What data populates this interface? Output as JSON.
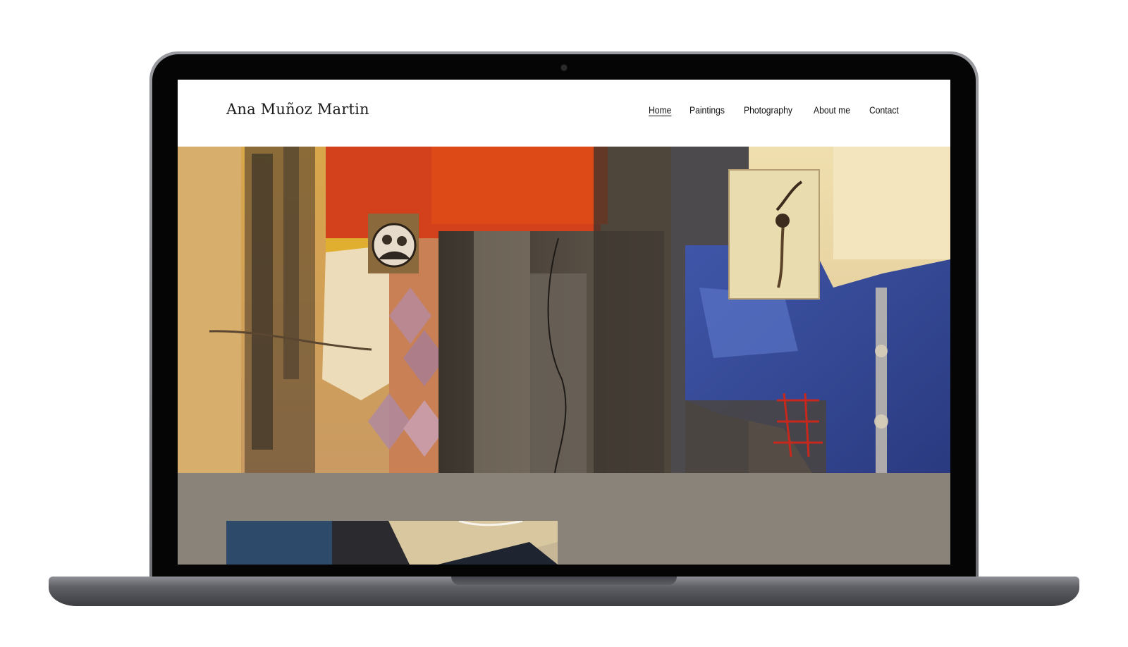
{
  "site": {
    "title": "Ana Muñoz Martin"
  },
  "nav": {
    "items": [
      {
        "label": "Home",
        "active": true
      },
      {
        "label": "Paintings",
        "active": false
      },
      {
        "label": "Photography",
        "active": false
      },
      {
        "label": "About me",
        "active": false
      },
      {
        "label": "Contact",
        "active": false
      }
    ]
  },
  "colors": {
    "device_frame": "#6e6f74",
    "section_background": "#8a837a",
    "text": "#111111"
  }
}
